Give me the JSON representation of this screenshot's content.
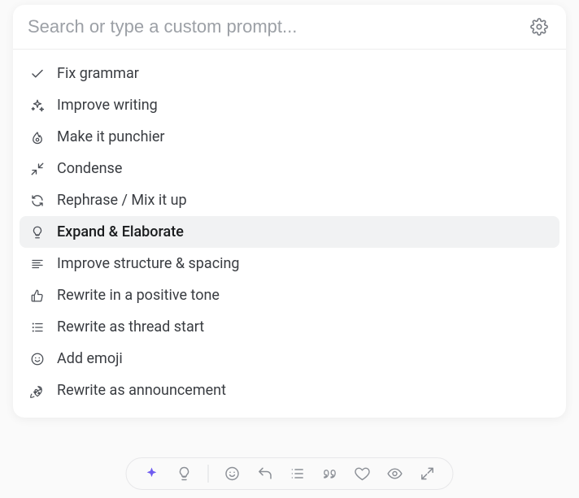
{
  "search": {
    "placeholder": "Search or type a custom prompt..."
  },
  "options": [
    {
      "icon": "check-icon",
      "label": "Fix grammar"
    },
    {
      "icon": "sparkles-icon",
      "label": "Improve writing"
    },
    {
      "icon": "flame-icon",
      "label": "Make it punchier"
    },
    {
      "icon": "collapse-icon",
      "label": "Condense"
    },
    {
      "icon": "refresh-icon",
      "label": "Rephrase / Mix it up"
    },
    {
      "icon": "bulb-icon",
      "label": "Expand & Elaborate",
      "highlighted": true
    },
    {
      "icon": "lines-icon",
      "label": "Improve structure & spacing"
    },
    {
      "icon": "thumbsup-icon",
      "label": "Rewrite in a positive tone"
    },
    {
      "icon": "thread-icon",
      "label": "Rewrite as thread start"
    },
    {
      "icon": "smile-icon",
      "label": "Add emoji"
    },
    {
      "icon": "rocket-icon",
      "label": "Rewrite as announcement"
    }
  ],
  "toolbar": {
    "items": [
      {
        "icon": "sparkle-icon",
        "active": true
      },
      {
        "icon": "bulb-icon"
      },
      {
        "divider": true
      },
      {
        "icon": "smile-icon"
      },
      {
        "icon": "reply-icon"
      },
      {
        "icon": "list-icon"
      },
      {
        "icon": "quote-icon"
      },
      {
        "icon": "heart-icon"
      },
      {
        "icon": "eye-icon"
      },
      {
        "icon": "expand-icon"
      }
    ]
  }
}
